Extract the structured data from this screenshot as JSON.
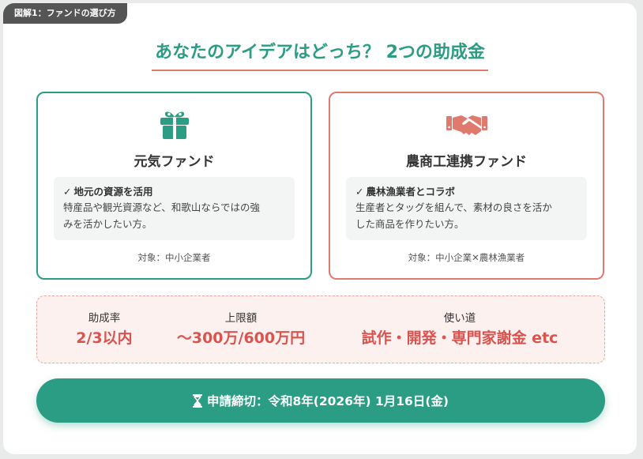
{
  "tag": "図解1：ファンドの選び方",
  "title": "あなたのアイデアはどっち？ 2つの助成金",
  "funds": [
    {
      "icon": "gift-icon",
      "name": "元気ファンド",
      "check": "✓",
      "head": "地元の資源を活用",
      "desc_line1": "特産品や観光資源など、和歌山ならではの強",
      "desc_line2": "みを活かしたい方。",
      "target": "対象：中小企業者",
      "color": "#2a9d84"
    },
    {
      "icon": "handshake-icon",
      "name": "農商工連携ファンド",
      "check": "✓",
      "head": "農林漁業者とコラボ",
      "desc_line1": "生産者とタッグを組んで、素材の良さを活か",
      "desc_line2": "した商品を作りたい方。",
      "target": "対象：中小企業✕農林漁業者",
      "color": "#e07a6e"
    }
  ],
  "stats": [
    {
      "label": "助成率",
      "value": "2/3以内"
    },
    {
      "label": "上限額",
      "value": "〜300万/600万円"
    },
    {
      "label": "使い道",
      "value": "試作・開発・専門家謝金 etc"
    }
  ],
  "deadline": {
    "icon": "hourglass-icon",
    "text": "申請締切：令和8年(2026年) 1月16日(金)"
  },
  "colors": {
    "accent_green": "#2a9d84",
    "accent_red": "#e07a6e",
    "value_red": "#d9534f"
  }
}
